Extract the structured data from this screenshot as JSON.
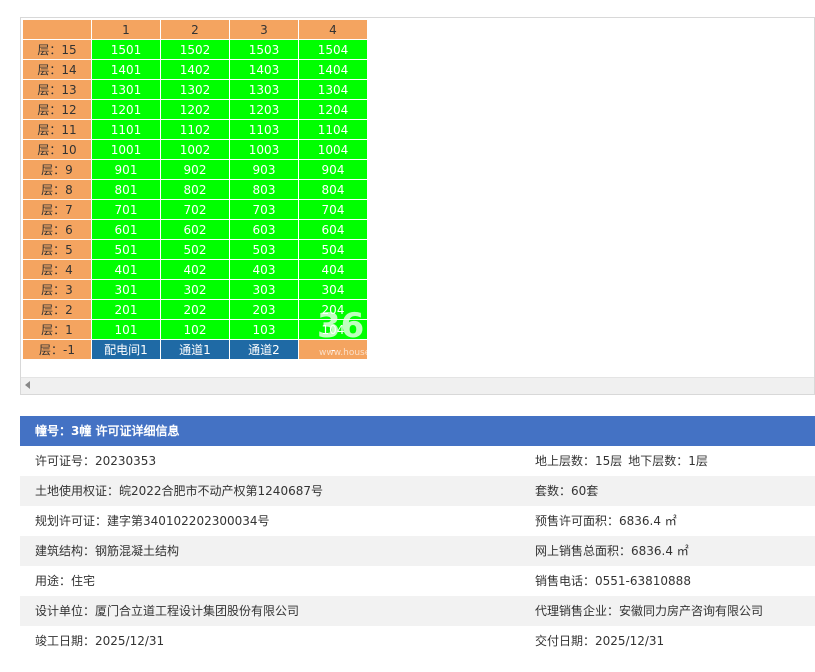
{
  "grid": {
    "columns": [
      "1",
      "2",
      "3",
      "4"
    ],
    "floors": [
      {
        "label": "层：15",
        "units": [
          "1501",
          "1502",
          "1503",
          "1504"
        ]
      },
      {
        "label": "层：14",
        "units": [
          "1401",
          "1402",
          "1403",
          "1404"
        ]
      },
      {
        "label": "层：13",
        "units": [
          "1301",
          "1302",
          "1303",
          "1304"
        ]
      },
      {
        "label": "层：12",
        "units": [
          "1201",
          "1202",
          "1203",
          "1204"
        ]
      },
      {
        "label": "层：11",
        "units": [
          "1101",
          "1102",
          "1103",
          "1104"
        ]
      },
      {
        "label": "层：10",
        "units": [
          "1001",
          "1002",
          "1003",
          "1004"
        ]
      },
      {
        "label": "层：9",
        "units": [
          "901",
          "902",
          "903",
          "904"
        ]
      },
      {
        "label": "层：8",
        "units": [
          "801",
          "802",
          "803",
          "804"
        ]
      },
      {
        "label": "层：7",
        "units": [
          "701",
          "702",
          "703",
          "704"
        ]
      },
      {
        "label": "层：6",
        "units": [
          "601",
          "602",
          "603",
          "604"
        ]
      },
      {
        "label": "层：5",
        "units": [
          "501",
          "502",
          "503",
          "504"
        ]
      },
      {
        "label": "层：4",
        "units": [
          "401",
          "402",
          "403",
          "404"
        ]
      },
      {
        "label": "层：3",
        "units": [
          "301",
          "302",
          "303",
          "304"
        ]
      },
      {
        "label": "层：2",
        "units": [
          "201",
          "202",
          "203",
          "204"
        ]
      },
      {
        "label": "层：1",
        "units": [
          "101",
          "102",
          "103",
          "104"
        ]
      }
    ],
    "basement": {
      "label": "层：-1",
      "units": [
        "配电间1",
        "通道1",
        "通道2",
        "-"
      ]
    },
    "colors": {
      "header": "#f4a460",
      "available": "#00ff00",
      "facility": "#1f6aa5"
    }
  },
  "watermark": {
    "main": "36",
    "sub": "www.house"
  },
  "info": {
    "title": "幢号：3幢 许可证详细信息",
    "rows": [
      {
        "left": "许可证号：20230353",
        "right_a": "地上层数：15层",
        "right_b": "地下层数：1层"
      },
      {
        "left": "土地使用权证：皖2022合肥市不动产权第1240687号",
        "right_a": "套数：60套",
        "right_b": ""
      },
      {
        "left": "规划许可证：建字第340102202300034号",
        "right_a": "预售许可面积：6836.4 ㎡",
        "right_b": ""
      },
      {
        "left": "建筑结构：钢筋混凝土结构",
        "right_a": "网上销售总面积：6836.4 ㎡",
        "right_b": ""
      },
      {
        "left": "用途：住宅",
        "right_a": "销售电话：0551-63810888",
        "right_b": ""
      },
      {
        "left": "设计单位：厦门合立道工程设计集团股份有限公司",
        "right_a": "代理销售企业：安徽同力房产咨询有限公司",
        "right_b": ""
      },
      {
        "left": "竣工日期：2025/12/31",
        "right_a": "交付日期：2025/12/31",
        "right_b": ""
      }
    ]
  }
}
